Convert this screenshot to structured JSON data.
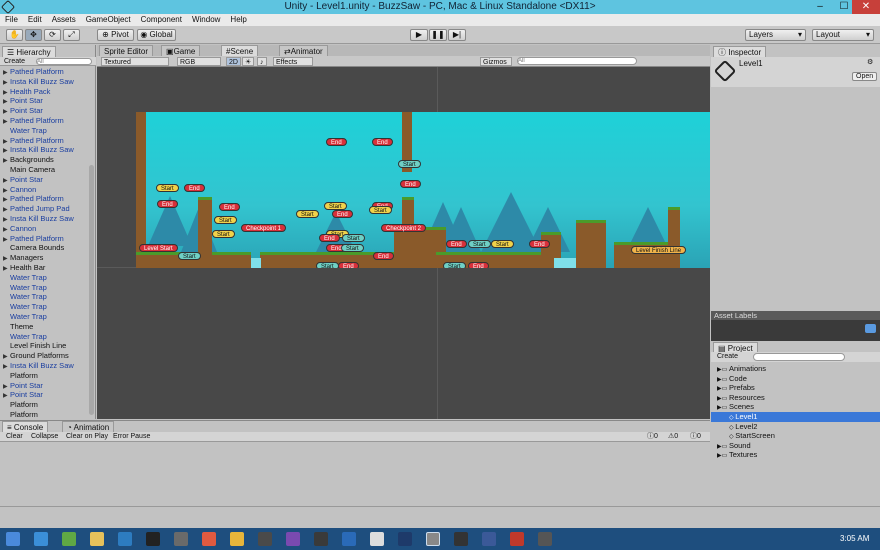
{
  "window": {
    "title": "Unity - Level1.unity - BuzzSaw - PC, Mac & Linux Standalone <DX11>",
    "minimize": "–",
    "maximize": "☐",
    "close": "✕"
  },
  "menu": [
    "File",
    "Edit",
    "Assets",
    "GameObject",
    "Component",
    "Window",
    "Help"
  ],
  "toolbar": {
    "pivot": "Pivot",
    "global": "Global",
    "layers": "Layers",
    "layout": "Layout"
  },
  "hierarchy": {
    "tab": "Hierarchy",
    "create": "Create",
    "search_placeholder": "All",
    "items": [
      {
        "label": "Pathed Platform",
        "blue": true,
        "arrow": true
      },
      {
        "label": "Insta Kill Buzz Saw",
        "blue": true,
        "arrow": true
      },
      {
        "label": "Health Pack",
        "blue": true,
        "arrow": true
      },
      {
        "label": "Point Star",
        "blue": true,
        "arrow": true
      },
      {
        "label": "Point Star",
        "blue": true,
        "arrow": true
      },
      {
        "label": "Pathed Platform",
        "blue": true,
        "arrow": true
      },
      {
        "label": "Water Trap",
        "blue": true,
        "arrow": false
      },
      {
        "label": "Pathed Platform",
        "blue": true,
        "arrow": true
      },
      {
        "label": "Insta Kill Buzz Saw",
        "blue": true,
        "arrow": true
      },
      {
        "label": "Backgrounds",
        "blue": false,
        "arrow": true
      },
      {
        "label": "Main Camera",
        "blue": false,
        "arrow": false
      },
      {
        "label": "Point Star",
        "blue": true,
        "arrow": true
      },
      {
        "label": "Cannon",
        "blue": true,
        "arrow": true
      },
      {
        "label": "Pathed Platform",
        "blue": true,
        "arrow": true
      },
      {
        "label": "Pathed Jump Pad",
        "blue": true,
        "arrow": true
      },
      {
        "label": "Insta Kill Buzz Saw",
        "blue": true,
        "arrow": true
      },
      {
        "label": "Cannon",
        "blue": true,
        "arrow": true
      },
      {
        "label": "Pathed Platform",
        "blue": true,
        "arrow": true
      },
      {
        "label": "Camera Bounds",
        "blue": false,
        "arrow": false
      },
      {
        "label": "Managers",
        "blue": false,
        "arrow": true
      },
      {
        "label": "Health Bar",
        "blue": false,
        "arrow": true
      },
      {
        "label": "Water Trap",
        "blue": true,
        "arrow": false
      },
      {
        "label": "Water Trap",
        "blue": true,
        "arrow": false
      },
      {
        "label": "Water Trap",
        "blue": true,
        "arrow": false
      },
      {
        "label": "Water Trap",
        "blue": true,
        "arrow": false
      },
      {
        "label": "Water Trap",
        "blue": true,
        "arrow": false
      },
      {
        "label": "Theme",
        "blue": false,
        "arrow": false
      },
      {
        "label": "Water Trap",
        "blue": true,
        "arrow": false
      },
      {
        "label": "Level Finish Line",
        "blue": false,
        "arrow": false
      },
      {
        "label": "Ground Platforms",
        "blue": false,
        "arrow": true
      },
      {
        "label": "Insta Kill Buzz Saw",
        "blue": true,
        "arrow": true
      },
      {
        "label": "Platform",
        "blue": false,
        "arrow": false
      },
      {
        "label": "Point Star",
        "blue": true,
        "arrow": true
      },
      {
        "label": "Point Star",
        "blue": true,
        "arrow": true
      },
      {
        "label": "Platform",
        "blue": false,
        "arrow": false
      },
      {
        "label": "Platform",
        "blue": false,
        "arrow": false
      }
    ]
  },
  "scene": {
    "tabs": [
      "Sprite Editor",
      "Game",
      "Scene",
      "Animator"
    ],
    "active_tab": "Scene",
    "textured": "Textured",
    "rgb": "RGB",
    "twod": "2D",
    "effects": "Effects",
    "gizmos": "Gizmos",
    "search_placeholder": "All"
  },
  "level_tags": [
    {
      "text": "End",
      "c": "red"
    },
    {
      "text": "End",
      "c": "red"
    },
    {
      "text": "Start",
      "c": "teal"
    },
    {
      "text": "End",
      "c": "red"
    },
    {
      "text": "Start",
      "c": "yellow"
    },
    {
      "text": "End",
      "c": "red"
    },
    {
      "text": "End",
      "c": "red"
    },
    {
      "text": "End",
      "c": "red"
    },
    {
      "text": "Start",
      "c": "yellow"
    },
    {
      "text": "Start",
      "c": "yellow"
    },
    {
      "text": "Start",
      "c": "yellow"
    },
    {
      "text": "End",
      "c": "red"
    },
    {
      "text": "Start",
      "c": "yellow"
    },
    {
      "text": "End",
      "c": "red"
    },
    {
      "text": "Start",
      "c": "yellow"
    },
    {
      "text": "Checkpoint 1",
      "c": "red"
    },
    {
      "text": "Start",
      "c": "yellow"
    },
    {
      "text": "Checkpoint 2",
      "c": "red"
    },
    {
      "text": "Level Start",
      "c": "red"
    },
    {
      "text": "Start",
      "c": "teal"
    },
    {
      "text": "End",
      "c": "red"
    },
    {
      "text": "Start",
      "c": "teal"
    },
    {
      "text": "End",
      "c": "red"
    },
    {
      "text": "Start",
      "c": "teal"
    },
    {
      "text": "Start",
      "c": "yellow"
    },
    {
      "text": "End",
      "c": "red"
    },
    {
      "text": "End",
      "c": "red"
    },
    {
      "text": "Start",
      "c": "teal"
    },
    {
      "text": "Start",
      "c": "teal"
    },
    {
      "text": "End",
      "c": "red"
    },
    {
      "text": "Level Finish Line",
      "c": "orange"
    },
    {
      "text": "End",
      "c": "red"
    },
    {
      "text": "Start",
      "c": "teal"
    },
    {
      "text": "End",
      "c": "red"
    }
  ],
  "inspector": {
    "tab": "Inspector",
    "object": "Level1",
    "open": "Open"
  },
  "asset_labels": {
    "title": "Asset Labels"
  },
  "project": {
    "tab": "Project",
    "create": "Create",
    "items": [
      {
        "label": "Animations",
        "indent": 0,
        "icon": "folder",
        "sel": false
      },
      {
        "label": "Code",
        "indent": 0,
        "icon": "folder",
        "sel": false
      },
      {
        "label": "Prefabs",
        "indent": 0,
        "icon": "folder",
        "sel": false
      },
      {
        "label": "Resources",
        "indent": 0,
        "icon": "folder",
        "sel": false
      },
      {
        "label": "Scenes",
        "indent": 0,
        "icon": "folder",
        "sel": false
      },
      {
        "label": "Level1",
        "indent": 1,
        "icon": "unity",
        "sel": true
      },
      {
        "label": "Level2",
        "indent": 1,
        "icon": "unity",
        "sel": false
      },
      {
        "label": "StartScreen",
        "indent": 1,
        "icon": "unity",
        "sel": false
      },
      {
        "label": "Sound",
        "indent": 0,
        "icon": "folder",
        "sel": false
      },
      {
        "label": "Textures",
        "indent": 0,
        "icon": "folder",
        "sel": false
      }
    ]
  },
  "console": {
    "tabs": [
      "Console",
      "Animation"
    ],
    "buttons": [
      "Clear",
      "Collapse",
      "Clear on Play",
      "Error Pause"
    ],
    "counts": [
      "0",
      "0",
      "0"
    ]
  },
  "taskbar": {
    "time": "3:05 AM"
  },
  "colors": {
    "sky": "#1ed1d8",
    "tag_red": "#d8303a",
    "tag_yellow": "#f1d24a",
    "tag_teal": "#6fd0c5",
    "selection": "#3a78d8",
    "taskbar": "#1e4e7e"
  }
}
